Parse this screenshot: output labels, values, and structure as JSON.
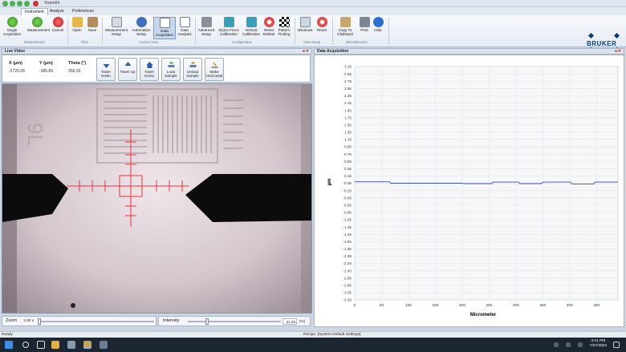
{
  "window": {
    "title": "Vision64"
  },
  "tabs": [
    "Instrument",
    "Analyze",
    "Preferences"
  ],
  "ribbon": {
    "buttons": [
      {
        "label": "Single Acquisition"
      },
      {
        "label": "Measurement"
      },
      {
        "label": "Cancel"
      },
      {
        "label": "Open"
      },
      {
        "label": "Save"
      },
      {
        "label": "Measurement Setup"
      },
      {
        "label": "Automation Setup"
      },
      {
        "label": "Data Acquisition"
      },
      {
        "label": "Data Analysis"
      },
      {
        "label": "Advanced Setup"
      },
      {
        "label": "Stylus Force Calibration"
      },
      {
        "label": "Vertical Calibration"
      },
      {
        "label": "Reset Dektak"
      },
      {
        "label": "Pattern Finding"
      },
      {
        "label": "Windows"
      },
      {
        "label": "Reset"
      },
      {
        "label": "Copy To Clipboard"
      },
      {
        "label": "Print"
      },
      {
        "label": "Help"
      }
    ],
    "groups": [
      "Measurement",
      "Files",
      "Current View",
      "Configuration",
      "View Setup",
      "Miscellaneous"
    ],
    "brand": "BRUKER",
    "brand_url": "www.bruker.com"
  },
  "live_video": {
    "title": "Live Video",
    "x_label": "X (µm)",
    "x_value": "-2729.28",
    "y_label": "Y (µm)",
    "y_value": "-385.89",
    "theta_label": "Theta (°)",
    "theta_value": "358.00",
    "buttons": [
      "Tower Down",
      "Tower Up",
      "Tower Home",
      "Load Sample",
      "Unload Sample",
      "Make Horizontal"
    ],
    "zoom_label": "Zoom",
    "zoom_value": "1.00 x",
    "intensity_label": "Intensity",
    "intensity_value": "21.35",
    "intensity_unit": "(%)"
  },
  "data_acquisition": {
    "title": "Data Acquisition"
  },
  "chart_data": {
    "type": "line",
    "title": "",
    "xlabel": "Micrometer",
    "ylabel": "µm",
    "xlim": [
      0,
      490
    ],
    "ylim": [
      -3.25,
      3.15
    ],
    "xticks": [
      0,
      50,
      100,
      150,
      200,
      250,
      300,
      350,
      400,
      450
    ],
    "yticks": [
      3.15,
      2.95,
      2.75,
      2.55,
      2.35,
      2.15,
      1.95,
      1.75,
      1.55,
      1.35,
      1.15,
      0.95,
      0.75,
      0.55,
      0.35,
      0.15,
      -0.05,
      -0.25,
      -0.45,
      -0.65,
      -0.85,
      -1.05,
      -1.25,
      -1.45,
      -1.65,
      -1.85,
      -2.05,
      -2.25,
      -2.45,
      -2.65,
      -2.85,
      -3.05,
      -3.25
    ],
    "grid": true,
    "series": [
      {
        "color": "#3a4fb8",
        "x": [
          0,
          65,
          67,
          200,
          202,
          255,
          257,
          305,
          307,
          348,
          350,
          402,
          404,
          445,
          447,
          490
        ],
        "y": [
          -0.01,
          -0.01,
          -0.05,
          -0.05,
          -0.06,
          -0.06,
          -0.02,
          -0.02,
          -0.06,
          -0.06,
          -0.02,
          -0.02,
          -0.07,
          -0.07,
          -0.02,
          -0.02
        ]
      }
    ]
  },
  "status": {
    "left": "Ready",
    "recipe": "Recipe: [System Default Settings]"
  },
  "taskbar": {
    "time": "3:21 PM",
    "date": "7/27/2022"
  }
}
